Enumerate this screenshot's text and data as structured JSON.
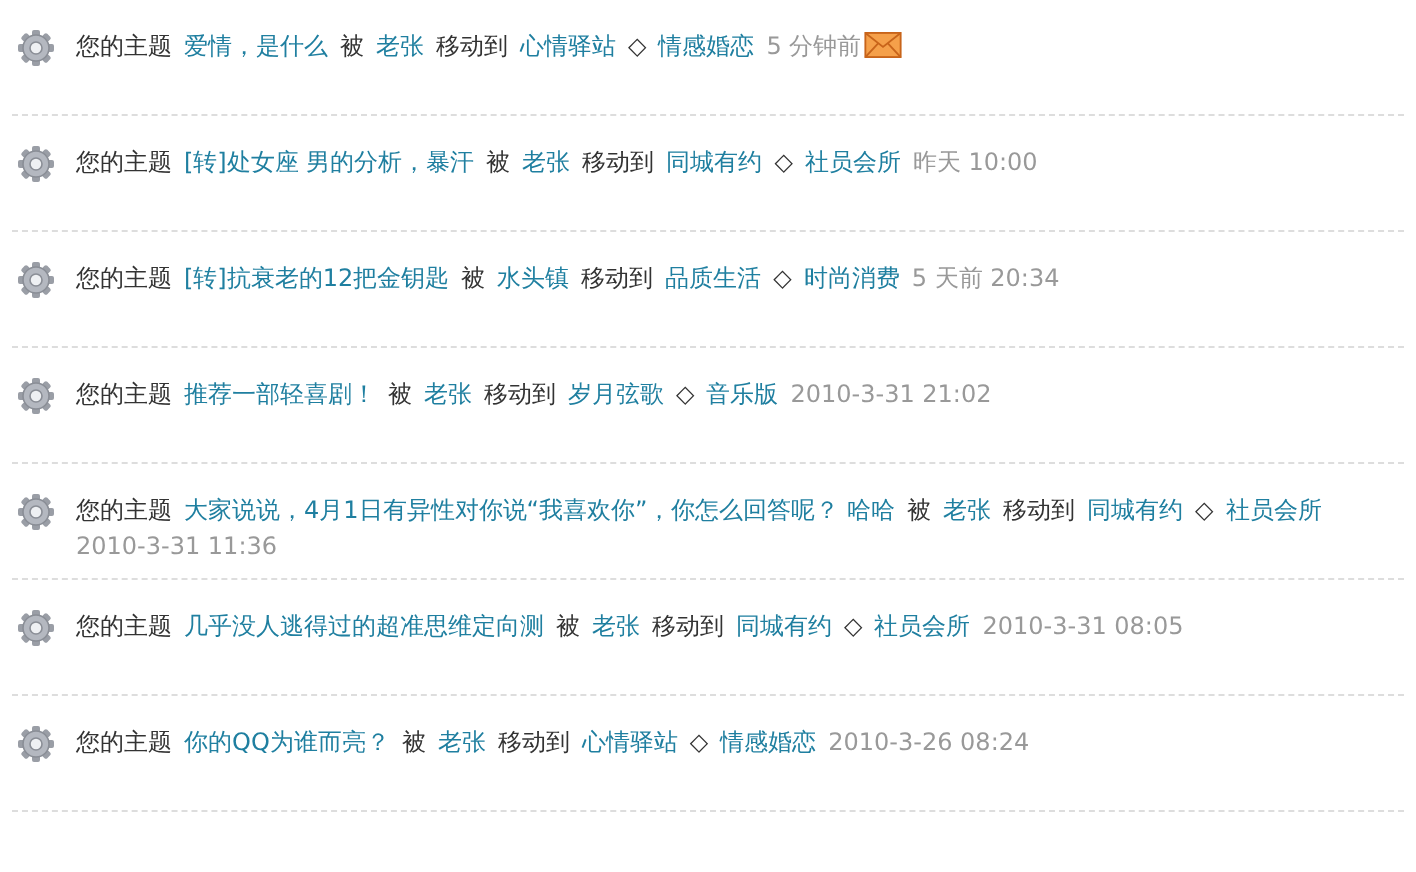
{
  "notices": [
    {
      "prefix": "您的主题",
      "topic": "爱情，是什么",
      "by": "被",
      "user": "老张",
      "moved_to": "移动到",
      "forum": "心情驿站",
      "separator": "◇",
      "subforum": "情感婚恋",
      "time": "5 分钟前",
      "new": true
    },
    {
      "prefix": "您的主题",
      "topic": "[转]处女座 男的分析，暴汗",
      "by": "被",
      "user": "老张",
      "moved_to": "移动到",
      "forum": "同城有约",
      "separator": "◇",
      "subforum": "社员会所",
      "time": "昨天 10:00",
      "new": false
    },
    {
      "prefix": "您的主题",
      "topic": "[转]抗衰老的12把金钥匙",
      "by": "被",
      "user": "水头镇",
      "moved_to": "移动到",
      "forum": "品质生活",
      "separator": "◇",
      "subforum": "时尚消费",
      "time": "5 天前 20:34",
      "new": false
    },
    {
      "prefix": "您的主题",
      "topic": "推荐一部轻喜剧！",
      "by": "被",
      "user": "老张",
      "moved_to": "移动到",
      "forum": "岁月弦歌",
      "separator": "◇",
      "subforum": "音乐版",
      "time": "2010-3-31 21:02",
      "new": false
    },
    {
      "prefix": "您的主题",
      "topic": "大家说说，4月1日有异性对你说“我喜欢你”，你怎么回答呢？ 哈哈",
      "by": "被",
      "user": "老张",
      "moved_to": "移动到",
      "forum": "同城有约",
      "separator": "◇",
      "subforum": "社员会所",
      "time": "2010-3-31 11:36",
      "new": false
    },
    {
      "prefix": "您的主题",
      "topic": "几乎没人逃得过的超准思维定向测",
      "by": "被",
      "user": "老张",
      "moved_to": "移动到",
      "forum": "同城有约",
      "separator": "◇",
      "subforum": "社员会所",
      "time": "2010-3-31 08:05",
      "new": false
    },
    {
      "prefix": "您的主题",
      "topic": "你的QQ为谁而亮？",
      "by": "被",
      "user": "老张",
      "moved_to": "移动到",
      "forum": "心情驿站",
      "separator": "◇",
      "subforum": "情感婚恋",
      "time": "2010-3-26 08:24",
      "new": false
    }
  ]
}
